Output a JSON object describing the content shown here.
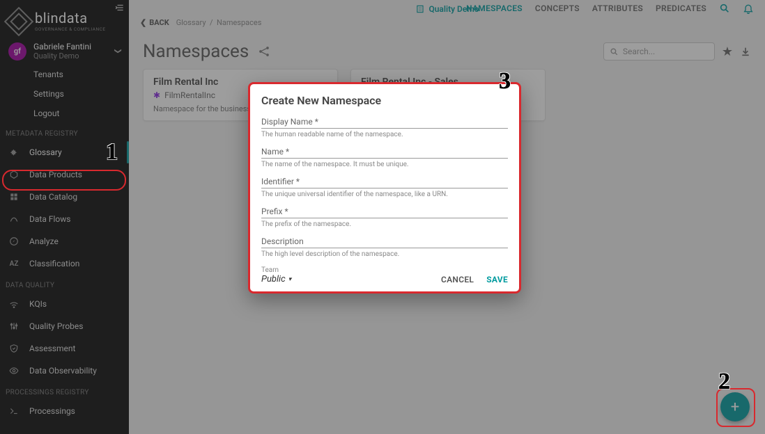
{
  "brand": {
    "name": "blindata",
    "tagline": "GOVERNANCE & COMPLIANCE"
  },
  "user": {
    "initials": "gf",
    "name": "Gabriele Fantini",
    "tenant": "Quality Demo"
  },
  "top_center": {
    "icon": "building-icon",
    "label": "Quality Demo"
  },
  "top_tabs": [
    "NAMESPACES",
    "CONCEPTS",
    "ATTRIBUTES",
    "PREDICATES"
  ],
  "top_active_tab": "NAMESPACES",
  "sidebar": {
    "user_sub": [
      "Tenants",
      "Settings",
      "Logout"
    ],
    "sections": [
      {
        "title": "METADATA REGISTRY",
        "items": [
          {
            "icon": "puzzle-icon",
            "label": "Glossary",
            "active": true
          },
          {
            "icon": "hex-icon",
            "label": "Data Products"
          },
          {
            "icon": "catalog-icon",
            "label": "Data Catalog"
          },
          {
            "icon": "flow-icon",
            "label": "Data Flows"
          },
          {
            "icon": "compass-icon",
            "label": "Analyze"
          },
          {
            "icon": "az-icon",
            "label": "Classification"
          }
        ]
      },
      {
        "title": "DATA QUALITY",
        "items": [
          {
            "icon": "wifi-icon",
            "label": "KQIs"
          },
          {
            "icon": "sliders-icon",
            "label": "Quality Probes"
          },
          {
            "icon": "shield-icon",
            "label": "Assessment"
          },
          {
            "icon": "eye-icon",
            "label": "Data Observability"
          }
        ]
      },
      {
        "title": "PROCESSINGS REGISTRY",
        "items": [
          {
            "icon": "proc-icon",
            "label": "Processings"
          }
        ]
      }
    ]
  },
  "crumbs": {
    "back": "BACK",
    "a": "Glossary",
    "b": "Namespaces"
  },
  "page": {
    "title": "Namespaces"
  },
  "search": {
    "placeholder": "Search..."
  },
  "cards": [
    {
      "title": "Film Rental Inc",
      "badge": "FilmRentalInc",
      "desc": "Namespace for the business ont…"
    },
    {
      "title": "Film Rental Inc - Sales"
    }
  ],
  "modal": {
    "title": "Create New Namespace",
    "fields": [
      {
        "label": "Display Name *",
        "help": "The human readable name of the namespace."
      },
      {
        "label": "Name *",
        "help": "The name of the namespace. It must be unique."
      },
      {
        "label": "Identifier *",
        "help": "The unique universal identifier of the namespace, like a URN."
      },
      {
        "label": "Prefix *",
        "help": "The prefix of the namespace."
      },
      {
        "label": "Description",
        "help": "The high level description of the namespace."
      }
    ],
    "team_caption": "Team",
    "team_value": "Public",
    "cancel": "CANCEL",
    "save": "SAVE"
  },
  "annotations": {
    "one": "1",
    "two": "2",
    "three": "3"
  }
}
